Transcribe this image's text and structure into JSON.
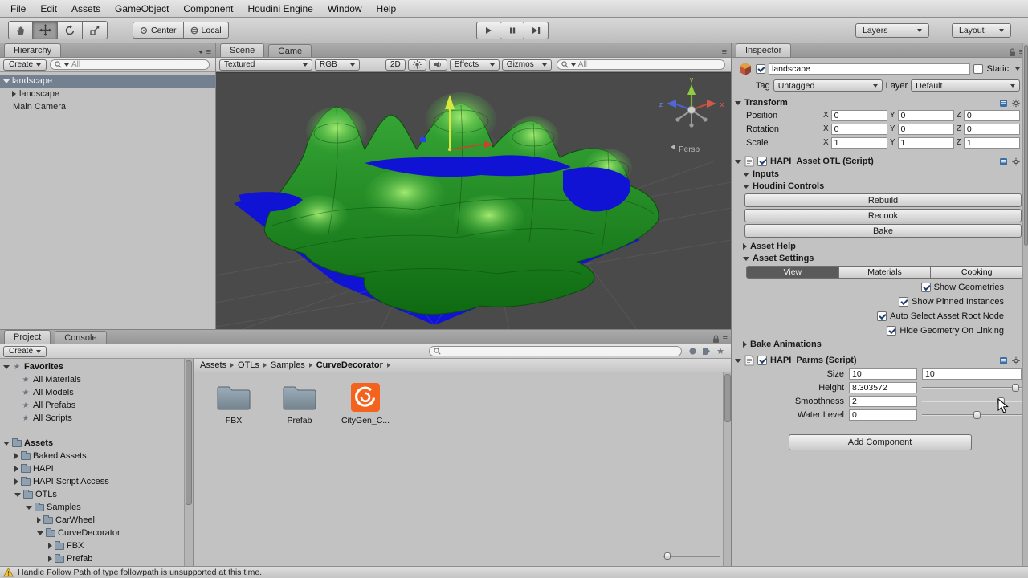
{
  "icons": {
    "star": "★",
    "menu": "≡"
  },
  "menubar": {
    "items": [
      "File",
      "Edit",
      "Assets",
      "GameObject",
      "Component",
      "Houdini Engine",
      "Window",
      "Help"
    ]
  },
  "toolbar": {
    "center": "Center",
    "local": "Local",
    "layers": "Layers",
    "layout": "Layout"
  },
  "hierarchy": {
    "tab": "Hierarchy",
    "create": "Create",
    "search_text": "All",
    "rows": [
      {
        "label": "landscape"
      },
      {
        "label": "landscape"
      },
      {
        "label": "Main Camera"
      }
    ]
  },
  "scene": {
    "tab_scene": "Scene",
    "tab_game": "Game",
    "shading": "Textured",
    "channel": "RGB",
    "mode2d": "2D",
    "effects": "Effects",
    "gizmos": "Gizmos",
    "search_text": "All",
    "axis": {
      "x": "x",
      "y": "y",
      "z": "z",
      "persp": "Persp"
    }
  },
  "project": {
    "tab_project": "Project",
    "tab_console": "Console",
    "create": "Create",
    "favorites_label": "Favorites",
    "favorites": [
      "All Materials",
      "All Models",
      "All Prefabs",
      "All Scripts"
    ],
    "assets_label": "Assets",
    "tree": [
      "Baked Assets",
      "HAPI",
      "HAPI Script Access",
      "OTLs",
      "Samples",
      "CarWheel",
      "CurveDecorator",
      "FBX",
      "Prefab"
    ],
    "breadcrumb": [
      "Assets",
      "OTLs",
      "Samples",
      "CurveDecorator"
    ],
    "items": [
      {
        "name": "FBX",
        "type": "folder"
      },
      {
        "name": "Prefab",
        "type": "folder"
      },
      {
        "name": "CityGen_C...",
        "type": "houdini"
      }
    ]
  },
  "inspector": {
    "tab": "Inspector",
    "name": "landscape",
    "static_label": "Static",
    "tag_label": "Tag",
    "tag": "Untagged",
    "layer_label": "Layer",
    "layer": "Default",
    "transform": {
      "title": "Transform",
      "axis_x": "X",
      "axis_y": "Y",
      "axis_z": "Z",
      "rows": [
        {
          "label": "Position",
          "x": "0",
          "y": "0",
          "z": "0"
        },
        {
          "label": "Rotation",
          "x": "0",
          "y": "0",
          "z": "0"
        },
        {
          "label": "Scale",
          "x": "1",
          "y": "1",
          "z": "1"
        }
      ]
    },
    "hapi_asset_title": "HAPI_Asset OTL (Script)",
    "inputs": "Inputs",
    "houdini_controls": "Houdini Controls",
    "rebuild": "Rebuild",
    "recook": "Recook",
    "bake": "Bake",
    "asset_help": "Asset Help",
    "asset_settings": "Asset Settings",
    "settings_tabs": [
      "View",
      "Materials",
      "Cooking"
    ],
    "settings_checks": [
      "Show Geometries",
      "Show Pinned Instances",
      "Auto Select Asset Root Node",
      "Hide Geometry On Linking"
    ],
    "bake_animations": "Bake Animations",
    "parms_title": "HAPI_Parms (Script)",
    "parms": [
      {
        "label": "Size",
        "value": "10",
        "value2": "10"
      },
      {
        "label": "Height",
        "value": "8.303572"
      },
      {
        "label": "Smoothness",
        "value": "2"
      },
      {
        "label": "Water Level",
        "value": "0"
      }
    ],
    "add_component": "Add Component"
  },
  "statusbar": {
    "message": "Handle Follow Path of type followpath is unsupported at this time."
  }
}
